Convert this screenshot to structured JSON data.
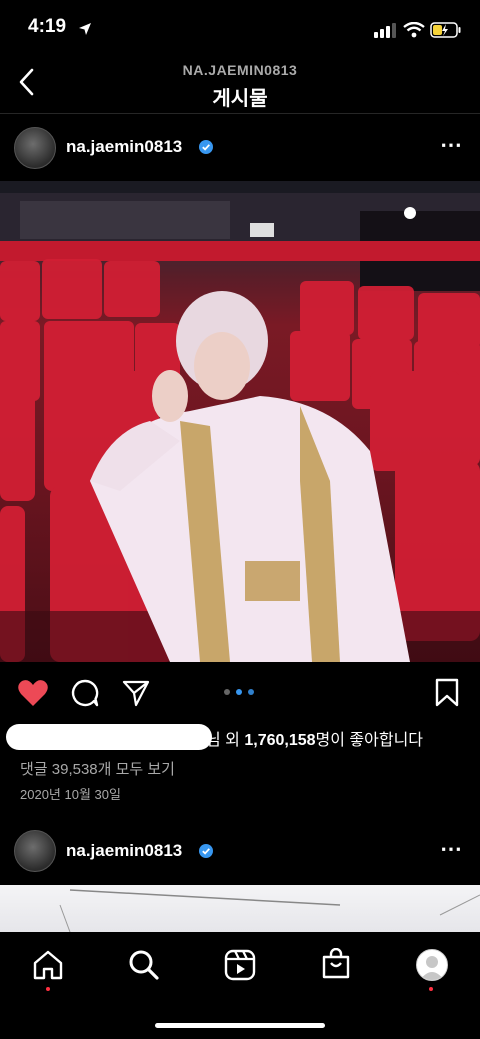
{
  "status_bar": {
    "time": "4:19"
  },
  "header": {
    "account": "NA.JAEMIN0813",
    "title": "게시물"
  },
  "post": {
    "username": "na.jaemin0813",
    "likes_suffix_1": "님 외 ",
    "likes_count": "1,760,158",
    "likes_suffix_2": "명이 좋아합니다",
    "comments_link": "댓글 39,538개 모두 보기",
    "date": "2020년 10월 30일",
    "carousel_dots": 3,
    "carousel_active": 1
  },
  "next_post": {
    "username": "na.jaemin0813"
  },
  "tabs": [
    "home",
    "search",
    "reels",
    "shop",
    "profile"
  ],
  "colors": {
    "like_red": "#ed4956",
    "verified_blue": "#3897f0",
    "carousel_active": "#3897f0"
  }
}
